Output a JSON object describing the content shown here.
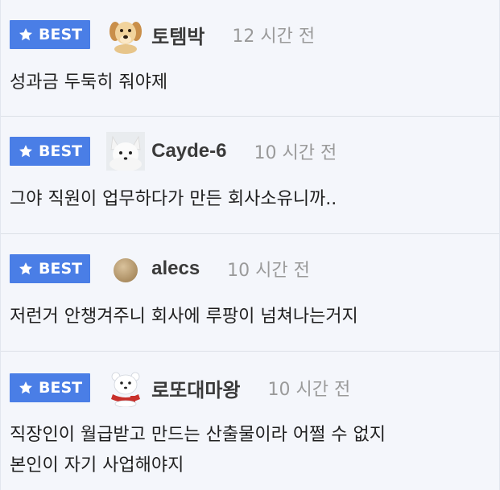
{
  "badge_label": "BEST",
  "comments": [
    {
      "avatar": "golden-retriever-puppy",
      "username": "토템박",
      "time": "12 시간 전",
      "lines": [
        "성과금 두둑히 줘야제"
      ]
    },
    {
      "avatar": "white-fox",
      "username": "Cayde-6",
      "time": "10 시간 전",
      "lines": [
        "그야 직원이 업무하다가 만든 회사소유니까.."
      ]
    },
    {
      "avatar": "tan-circle",
      "username": "alecs",
      "time": "10 시간 전",
      "lines": [
        "저런거 안챙겨주니 회사에 루팡이 넘쳐나는거지"
      ]
    },
    {
      "avatar": "white-bear-red-scarf",
      "username": "로또대마왕",
      "time": "10 시간 전",
      "lines": [
        "직장인이 월급받고 만드는 산출물이라 어쩔 수 없지",
        "본인이 자기 사업해야지"
      ]
    }
  ],
  "colors": {
    "badge": "#4a7ee6",
    "background": "#f4f6fb",
    "time": "#9a9a9a",
    "username": "#3a3a3a"
  }
}
